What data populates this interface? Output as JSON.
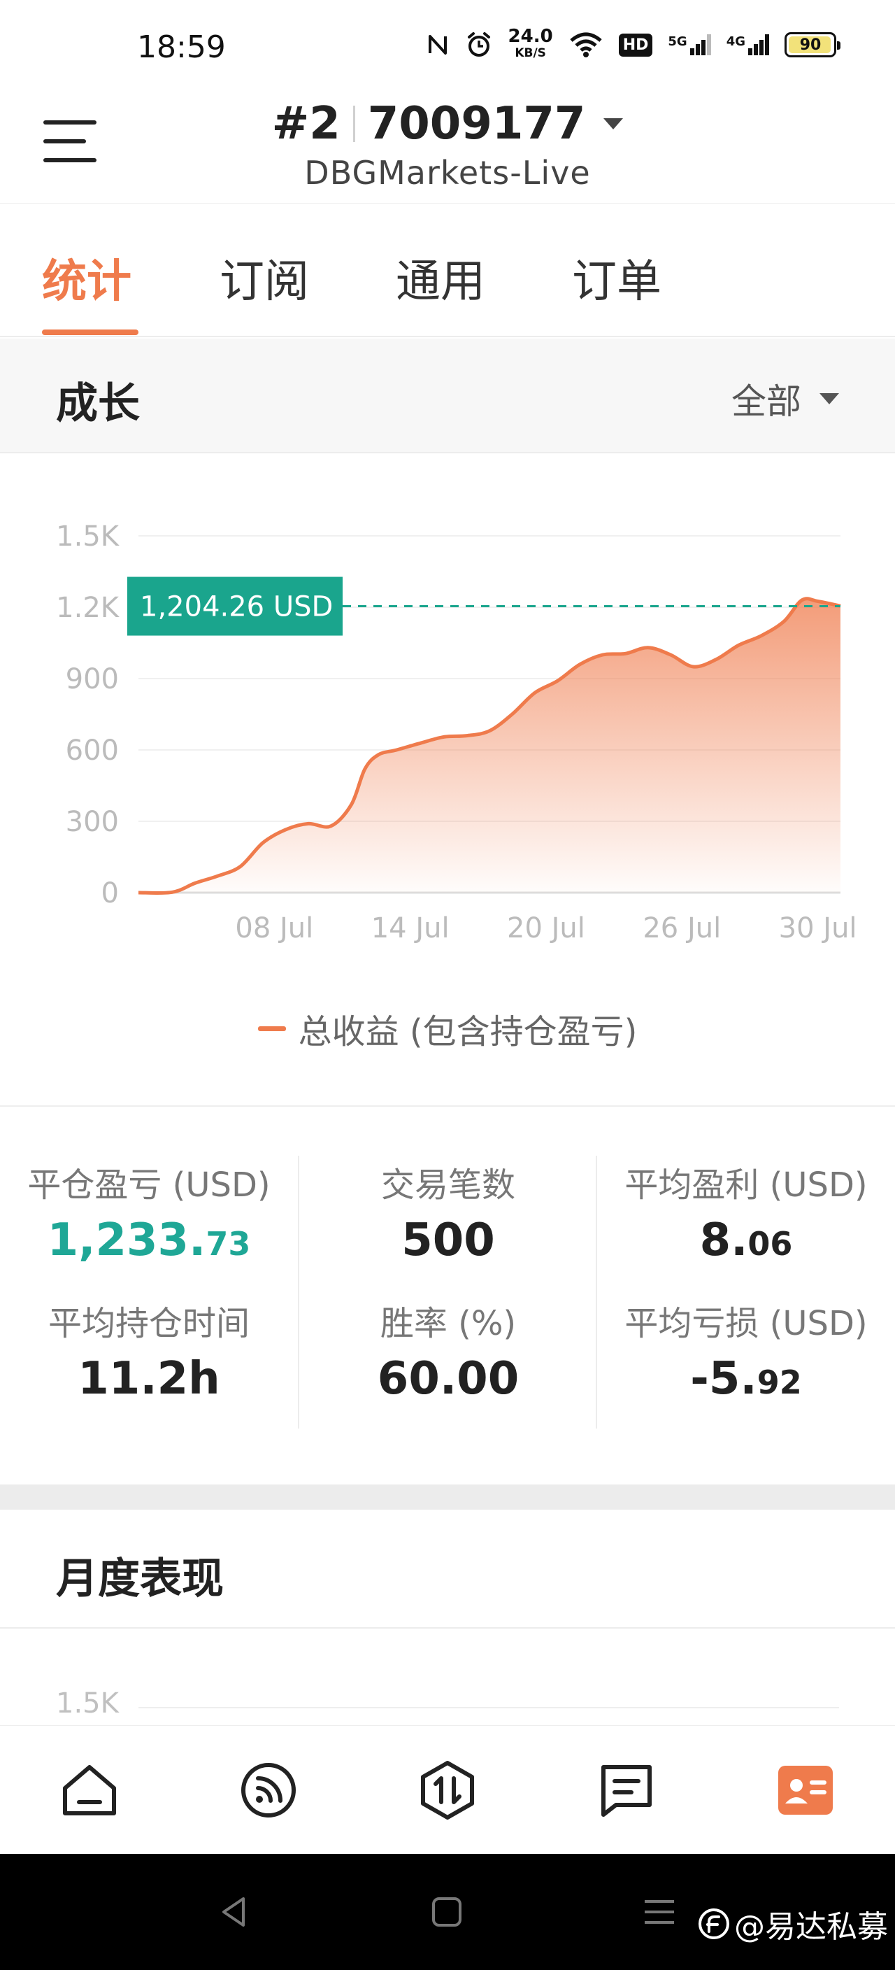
{
  "status_bar": {
    "time": "18:59",
    "net_speed_value": "24.0",
    "net_speed_unit": "KB/S",
    "hd_badge": "HD",
    "net_5g": "5G",
    "net_4g": "4G",
    "battery": "90"
  },
  "header": {
    "account_index": "#2",
    "account_number": "7009177",
    "server": "DBGMarkets-Live"
  },
  "tabs": [
    {
      "label": "统计",
      "active": true
    },
    {
      "label": "订阅",
      "active": false
    },
    {
      "label": "通用",
      "active": false
    },
    {
      "label": "订单",
      "active": false
    }
  ],
  "growth": {
    "title": "成长",
    "range": "全部"
  },
  "chart_data": {
    "type": "area",
    "y_ticks": [
      "1.5K",
      "1.2K",
      "900",
      "600",
      "300",
      "0"
    ],
    "y_tick_values": [
      1500,
      1200,
      900,
      600,
      300,
      0
    ],
    "x_ticks": [
      "08 Jul",
      "14 Jul",
      "20 Jul",
      "26 Jul",
      "30 Jul"
    ],
    "x_tick_values": [
      8,
      14,
      20,
      26,
      32
    ],
    "ylim": [
      0,
      1500
    ],
    "xlim": [
      2,
      33
    ],
    "grid": true,
    "legend_position": "bottom",
    "current_value_label": "1,204.26 USD",
    "current_value": 1204.26,
    "series": [
      {
        "name": "总收益 (包含持仓盈亏)",
        "color": "#ef7b4c",
        "x": [
          2,
          3.5,
          4.5,
          5.5,
          6.5,
          7.5,
          8.5,
          9.5,
          10.5,
          11.4,
          12,
          12.6,
          13.4,
          14.5,
          15.5,
          16.5,
          17.5,
          18.5,
          19.5,
          20.5,
          21.5,
          22.5,
          23.5,
          24.5,
          25.5,
          26.5,
          27.5,
          28.5,
          29.5,
          30.5,
          31.3,
          32,
          33
        ],
        "values": [
          0,
          2,
          40,
          70,
          110,
          210,
          265,
          290,
          280,
          370,
          520,
          580,
          600,
          630,
          655,
          660,
          680,
          750,
          840,
          890,
          960,
          1000,
          1005,
          1030,
          1000,
          950,
          980,
          1040,
          1080,
          1140,
          1230,
          1225,
          1205
        ]
      }
    ]
  },
  "stats": {
    "closed_pnl": {
      "label": "平仓盈亏 (USD)",
      "int": "1,233.",
      "dec": "73"
    },
    "trade_count": {
      "label": "交易笔数",
      "value": "500"
    },
    "avg_profit": {
      "label": "平均盈利 (USD)",
      "int": "8.",
      "dec": "06"
    },
    "avg_hold": {
      "label": "平均持仓时间",
      "value": "11.2h"
    },
    "win_rate": {
      "label": "胜率 (%)",
      "value": "60.00"
    },
    "avg_loss": {
      "label": "平均亏损 (USD)",
      "int": "-5.",
      "dec": "92"
    }
  },
  "monthly": {
    "title": "月度表现",
    "y_top_tick": "1.5K"
  },
  "bottom_nav": [
    {
      "icon": "home-icon",
      "active": false
    },
    {
      "icon": "feed-icon",
      "active": false
    },
    {
      "icon": "trade-icon",
      "active": false
    },
    {
      "icon": "messages-icon",
      "active": false
    },
    {
      "icon": "account-card-icon",
      "active": true
    }
  ],
  "colors": {
    "accent": "#ef7b4c",
    "positive": "#1fa796",
    "value_tag": "#1aa58d"
  },
  "watermark": "@易达私募"
}
